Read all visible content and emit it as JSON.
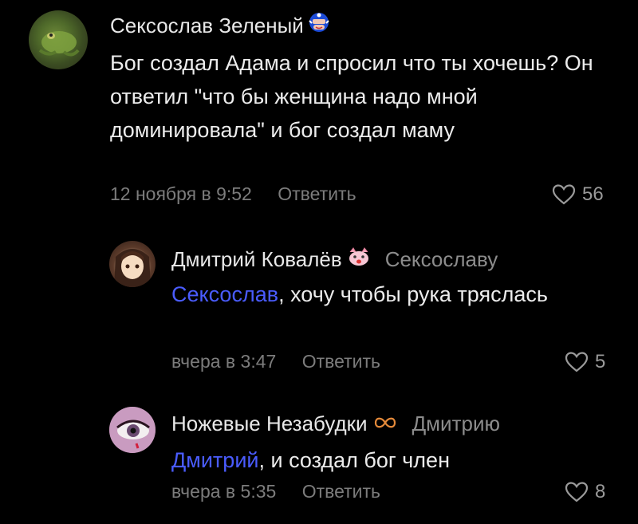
{
  "comments": [
    {
      "author": "Сексослав Зеленый",
      "reply_to": "",
      "mention": "",
      "text": "Бог создал Адама и спросил что ты хочешь? Он ответил \"что бы женщина надо мной доминировала\" и бог создал маму",
      "date": "12 ноября в 9:52",
      "reply_label": "Ответить",
      "likes": "56",
      "badge_icon": "captain-america-badge-icon"
    },
    {
      "author": "Дмитрий Ковалёв",
      "reply_to": "Сексославу",
      "mention": "Сексослав",
      "text": ", хочу чтобы рука тряслась",
      "date": "вчера в 3:47",
      "reply_label": "Ответить",
      "likes": "5",
      "badge_icon": "cat-face-badge-icon"
    },
    {
      "author": "Ножевые Незабудки",
      "reply_to": "Дмитрию",
      "mention": "Дмитрий",
      "text": ", и создал бог член",
      "date": "вчера в 5:35",
      "reply_label": "Ответить",
      "likes": "8",
      "badge_icon": "infinity-badge-icon"
    }
  ],
  "colors": {
    "background": "#000000",
    "mention": "#4a5cff",
    "meta": "#7c7c7c"
  }
}
